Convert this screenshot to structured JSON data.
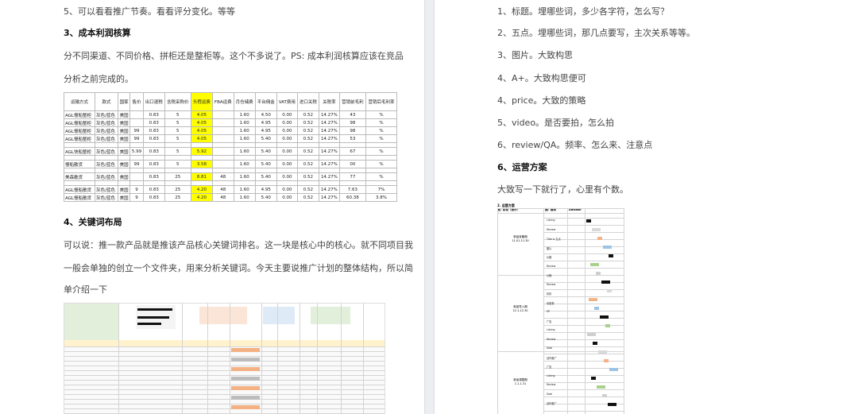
{
  "left": {
    "line_5": "5、可以看看推广节奏。看看评分变化。等等",
    "h_cost": "3、成本利润核算",
    "cost_p1": "分不同渠道、不同价格、拼柜还是整柜等。这个不多说了。PS: 成本利润核算应该在竞品",
    "cost_p2": "分析之前完成的。",
    "table": {
      "headers": [
        "运输方式",
        "款式",
        "国家",
        "售价",
        "出口退税",
        "含税采购价",
        "头程运费",
        "FBA运费",
        "月仓储费",
        "平台佣金",
        "VAT费用",
        "进口关税",
        "关税率",
        "营销前毛利",
        "营销后毛利率"
      ],
      "rows": [
        [
          "AGL慢船整柜",
          "灰色/蓝色",
          "美国",
          "",
          "0.83",
          "5",
          "4.05",
          "",
          "1.60",
          "4.50",
          "0.00",
          "0.52",
          "14.27%",
          "43",
          "%"
        ],
        [
          "AGL慢船整柜",
          "灰色/蓝色",
          "美国",
          "",
          "0.83",
          "5",
          "4.05",
          "",
          "1.60",
          "4.95",
          "0.00",
          "0.52",
          "14.27%",
          "98",
          "%"
        ],
        [
          "AGL慢船整柜",
          "灰色/蓝色",
          "美国",
          "99",
          "0.83",
          "5",
          "4.05",
          "",
          "1.60",
          "4.95",
          "0.00",
          "0.52",
          "14.27%",
          "98",
          "%"
        ],
        [
          "AGL慢船整柜",
          "灰色/蓝色",
          "美国",
          "99",
          "0.83",
          "5",
          "4.05",
          "",
          "1.60",
          "5.40",
          "0.00",
          "0.52",
          "14.27%",
          "53",
          "%"
        ],
        [
          "AGL快船整柜",
          "灰色/蓝色",
          "美国",
          "5.99",
          "0.83",
          "5",
          "5.92",
          "",
          "1.60",
          "5.40",
          "0.00",
          "0.52",
          "14.27%",
          "67",
          "%"
        ],
        [
          "慢船散货",
          "灰色/蓝色",
          "美国",
          "99",
          "0.83",
          "5",
          "3.58",
          "",
          "1.60",
          "5.40",
          "0.00",
          "0.52",
          "14.27%",
          "00",
          "%"
        ],
        [
          "美森散货",
          "灰色/蓝色",
          "美国",
          "",
          "0.83",
          "25",
          "8.81",
          "48",
          "1.60",
          "5.40",
          "0.00",
          "0.52",
          "14.27%",
          "77",
          "%"
        ],
        [
          "AGL慢船散货",
          "灰色/蓝色",
          "美国",
          "9",
          "0.83",
          "25",
          "4.20",
          "48",
          "1.60",
          "4.95",
          "0.00",
          "0.52",
          "14.27%",
          "7.63",
          "7%"
        ],
        [
          "AGL慢船散货",
          "灰色/蓝色",
          "美国",
          "9",
          "0.83",
          "25",
          "4.20",
          "48",
          "1.60",
          "5.40",
          "0.00",
          "0.52",
          "14.27%",
          "60.38",
          "3.8%"
        ]
      ]
    },
    "h_keyword": "4、关键词布局",
    "kw_p1": "可以说：推一款产品就是推该产品核心关键词排名。这一块是核心中的核心。就不同项目我",
    "kw_p2": "一般会单独的创立一个文件夹，用来分析关键词。今天主要说推广计划的整体结构，所以简",
    "kw_p3": "单介绍一下"
  },
  "right": {
    "items": [
      "1、标题。埋哪些词，多少各字符，怎么写？",
      "2、五点。埋哪些词，那几点要写，主次关系等等。",
      "3、图片。大致构思",
      "4、A+。大致构思便可",
      "4、price。大致的策略",
      "5、video。是否要拍，怎么拍",
      "6、review/QA。频率、怎么来、注意点"
    ],
    "h_ops": "6、运营方案",
    "ops_p": "大致写一下就行了，心里有个数。",
    "mini": {
      "title": "2. 运营方案",
      "col1": "推广阶段（预计）",
      "col2": "推广模块",
      "col3": "Amazon",
      "phases": [
        "新品准备期\n11.01-11.30",
        "新品导入期\n12.1-12.30",
        "新品调整期\n1.1-1.31"
      ],
      "labels": [
        "Listing",
        "Review",
        "Title & 五点",
        "图片",
        "价格",
        "Review",
        "价格",
        "Review",
        "折扣",
        "优惠券",
        "SP",
        "广告",
        "Listing",
        "Review",
        "Deal",
        "站外推广",
        "广告",
        "Listing",
        "Review",
        "Deal",
        "站外推广"
      ]
    }
  }
}
